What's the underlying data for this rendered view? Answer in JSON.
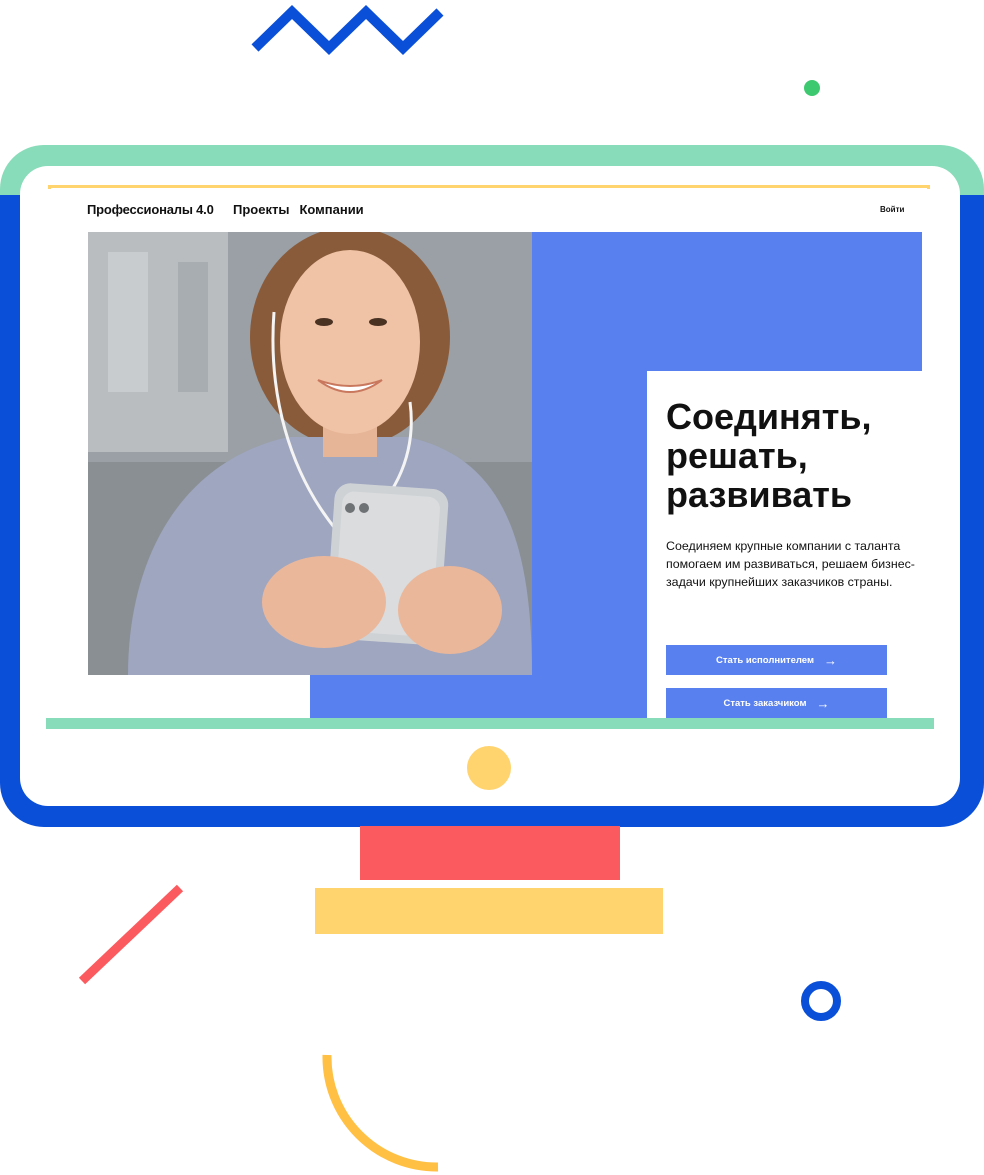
{
  "site": {
    "logo": "Профессионалы 4.0",
    "nav": [
      "Проекты",
      "Компании"
    ],
    "login": "Войти"
  },
  "hero": {
    "headline_lines": [
      "Соединять,",
      "решать,",
      "развивать"
    ],
    "subtext": "Соединяем крупные компании с таланта помогаем им развиваться, решаем бизнес-задачи крупнейших заказчиков страны.",
    "buttons": [
      {
        "label": "Стать исполнителем",
        "icon": "arrow-right-icon"
      },
      {
        "label": "Стать заказчиком",
        "icon": "arrow-right-icon"
      }
    ],
    "photo": "woman-with-phone-photo"
  },
  "colors": {
    "accent_blue": "#5980ef",
    "frame_green": "#88dcb9",
    "frame_blue": "#0a4fd8",
    "red": "#fb5a5e",
    "yellow": "#ffd36e"
  }
}
